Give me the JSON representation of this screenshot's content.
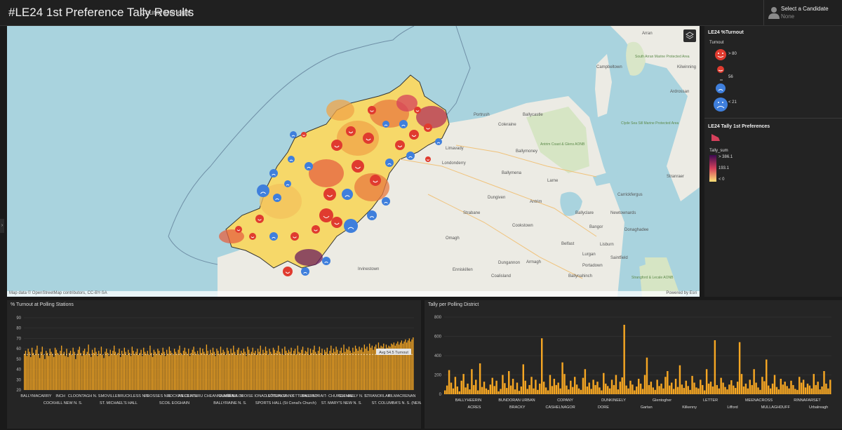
{
  "header": {
    "title": "#LE24 1st Preference Tally Results",
    "subtitle": "County Donegal",
    "candidate_label": "Select a Candidate",
    "candidate_value": "None"
  },
  "map": {
    "attribution": "Map data © OpenStreetMap contributors, CC-BY-SA",
    "powered_by": "Powered by Esri",
    "place_labels": [
      "Arran",
      "Campbeltown",
      "Portrush",
      "Ballycastle",
      "Coleraine",
      "Limavady",
      "Londonderry",
      "Ballymoney",
      "Ballymena",
      "Larne",
      "Antrim",
      "Dungiven",
      "Strabane",
      "Cookstown",
      "Omagh",
      "Belfast",
      "Bangor",
      "Newtownards",
      "Lisburn",
      "Dungannon",
      "Enniskillen",
      "Armagh",
      "Portadown",
      "Lurgan",
      "Ballyclare",
      "Carrickfergus",
      "Donaghadee",
      "Irvinestown",
      "Coalisland",
      "Saintfield",
      "Ballynahinch",
      "Stranraer",
      "Kilwinning",
      "Ardrossan"
    ],
    "area_labels": [
      "Clyde Sea Sill Marine Protected Area",
      "Antrim Coast & Glens AONB",
      "Strangford & Lecale AONB",
      "South Arran Marine Protected Area"
    ]
  },
  "legend": {
    "turnout_title": "LE24 %Turnout",
    "turnout_sub": "Turnout",
    "turnout_labels": [
      "> 80",
      "56",
      "< 21"
    ],
    "tally_title": "LE24 Tally 1st Preferences",
    "tally_sub": "Tally_sum",
    "tally_labels": [
      "> 386.1",
      "193.1",
      "< 0"
    ],
    "colors": {
      "high": "#e03b2f",
      "low": "#3f7fdc",
      "ramp_top": "#3b0a50",
      "ramp_mid": "#d5405b",
      "ramp_low": "#fbe276",
      "bar": "#f5a623"
    }
  },
  "charts": {
    "turnout": {
      "title": "% Turnout at Polling Stations",
      "tooltip": "Avg 54.5 Turnout",
      "row1": [
        "BALLYMACARRY",
        "INCH",
        "CLOONTAGH N. S.",
        "MOVILLE",
        "BRUCKLESS N.S.",
        "FROSSES N.S.",
        "ROCKFIELD N.S.",
        "AN CEATHRU CHEANNAIN S.N.",
        "GLASÁN S. N.",
        "MÍN NA CROISE IONAD SÓISIALTA",
        "LETTERKENNY",
        "LETTERKENNY",
        "BALLINDRAIT- CHURCH HALL",
        "GLENEELY N. S.",
        "STRANORLAR",
        "KILMACRENAN"
      ],
      "row2": [
        "COCKHILL NEW N. S.",
        "ST. MICHAEL'S HALL",
        "SCOIL EOGHAIN",
        "BALLYRAINE N. S.",
        "SPORTS HALL (St Conal's Church)",
        "ST. MARY'S NEW N. S.",
        "ST. COLUMBA'S N. S. (NEW)"
      ]
    },
    "tally": {
      "title": "Tally per Polling District",
      "row1": [
        "BALLYHEERIN",
        "BUNDORAN URBAN",
        "COPANY",
        "DUNKINEELY",
        "Glentogher",
        "LETTER",
        "MEENACROSS",
        "RINNAFARSET"
      ],
      "row2": [
        "ACRES",
        "BRACKY",
        "CASHELNAGOR",
        "DORE",
        "Gartan",
        "Kilkenny",
        "Lifford",
        "MULLAGHDUFF",
        "Urbalreagh"
      ]
    }
  },
  "chart_data": [
    {
      "type": "bar",
      "title": "% Turnout at Polling Stations",
      "ylim": [
        20,
        90
      ],
      "yticks": [
        20,
        30,
        40,
        50,
        60,
        70,
        80,
        90
      ],
      "reference_line": 54.5,
      "values": [
        55,
        58,
        53,
        60,
        57,
        52,
        61,
        56,
        54,
        59,
        63,
        55,
        51,
        57,
        62,
        54,
        50,
        58,
        56,
        53,
        60,
        57,
        55,
        52,
        61,
        59,
        56,
        54,
        58,
        63,
        55,
        57,
        53,
        60,
        52,
        56,
        58,
        54,
        61,
        57,
        50,
        55,
        59,
        62,
        56,
        53,
        58,
        60,
        54,
        57,
        64,
        55,
        52,
        59,
        56,
        61,
        57,
        53,
        58,
        55,
        62,
        54,
        51,
        57,
        60,
        56,
        53,
        59,
        55,
        58,
        63,
        57,
        54,
        56,
        60,
        52,
        58,
        55,
        61,
        57,
        54,
        59,
        56,
        53,
        62,
        58,
        55,
        57,
        60,
        54,
        56,
        59,
        53,
        61,
        57,
        55,
        58,
        54,
        63,
        56,
        52,
        59,
        57,
        55,
        60,
        58,
        54,
        56,
        61,
        57,
        53,
        59,
        55,
        62,
        58,
        56,
        54,
        60,
        57,
        55,
        59,
        63,
        56,
        54,
        58,
        61,
        57,
        55,
        60,
        53,
        56,
        59,
        62,
        57,
        55,
        58,
        54,
        61,
        56,
        60,
        57,
        55,
        64,
        58,
        54,
        59,
        56,
        61,
        57,
        53,
        60,
        58,
        55,
        62,
        56,
        59,
        57,
        54,
        61,
        58,
        55,
        60,
        56,
        63,
        57,
        54,
        59,
        61,
        55,
        58,
        56,
        60,
        57,
        53,
        62,
        59,
        55,
        57,
        61,
        56,
        58,
        54,
        60,
        57,
        63,
        55,
        59,
        56,
        62,
        58,
        54,
        60,
        57,
        55,
        61,
        59,
        56,
        58,
        63,
        57,
        55,
        60,
        54,
        62,
        58,
        56,
        59,
        57,
        61,
        55,
        58,
        60,
        54,
        63,
        57,
        56,
        59,
        62,
        55,
        58,
        57,
        61,
        54,
        60,
        56,
        59,
        63,
        57,
        55,
        58,
        62,
        56,
        60,
        54,
        59,
        57,
        61,
        55,
        58,
        63,
        56,
        60,
        57,
        62,
        59,
        55,
        58,
        61,
        56,
        64,
        57,
        60,
        59,
        62,
        58,
        56,
        61,
        57,
        63,
        60,
        58,
        62,
        59,
        61,
        57,
        64,
        60,
        62,
        58,
        65,
        61,
        63,
        59,
        62,
        64,
        60,
        66,
        61,
        63,
        62,
        65,
        60,
        64,
        61,
        63,
        62,
        65,
        64,
        66,
        63,
        65,
        67,
        64,
        66,
        68,
        65,
        67,
        69,
        66,
        68,
        70,
        67,
        69,
        71
      ]
    },
    {
      "type": "bar",
      "title": "Tally per Polling District",
      "ylim": [
        0,
        800
      ],
      "yticks": [
        0,
        200,
        400,
        600,
        800
      ],
      "values": [
        40,
        90,
        250,
        120,
        60,
        180,
        80,
        30,
        140,
        210,
        70,
        110,
        50,
        260,
        95,
        150,
        40,
        320,
        75,
        130,
        60,
        45,
        100,
        170,
        85,
        140,
        30,
        55,
        200,
        115,
        65,
        240,
        90,
        160,
        50,
        120,
        35,
        80,
        310,
        140,
        55,
        95,
        180,
        60,
        150,
        45,
        110,
        580,
        130,
        70,
        40,
        200,
        85,
        160,
        95,
        120,
        60,
        330,
        210,
        90,
        50,
        140,
        75,
        180,
        100,
        60,
        45,
        170,
        260,
        80,
        120,
        55,
        150,
        95,
        130,
        70,
        40,
        220,
        110,
        85,
        60,
        150,
        95,
        200,
        50,
        130,
        175,
        720,
        90,
        60,
        140,
        100,
        40,
        80,
        160,
        110,
        55,
        200,
        380,
        95,
        130,
        70,
        45,
        150,
        85,
        110,
        60,
        180,
        240,
        90,
        120,
        55,
        160,
        75,
        300,
        100,
        65,
        140,
        85,
        45,
        190,
        120,
        70,
        60,
        150,
        95,
        40,
        260,
        110,
        130,
        80,
        560,
        95,
        60,
        170,
        120,
        75,
        50,
        100,
        145,
        90,
        65,
        130,
        540,
        210,
        80,
        110,
        60,
        150,
        95,
        260,
        120,
        70,
        45,
        180,
        135,
        360,
        90,
        60,
        110,
        200,
        75,
        50,
        160,
        100,
        130,
        85,
        60,
        140,
        95,
        55,
        45,
        180,
        120,
        150,
        70,
        110,
        90,
        60,
        210,
        95,
        130,
        50,
        80,
        240,
        110,
        60,
        150
      ]
    }
  ]
}
